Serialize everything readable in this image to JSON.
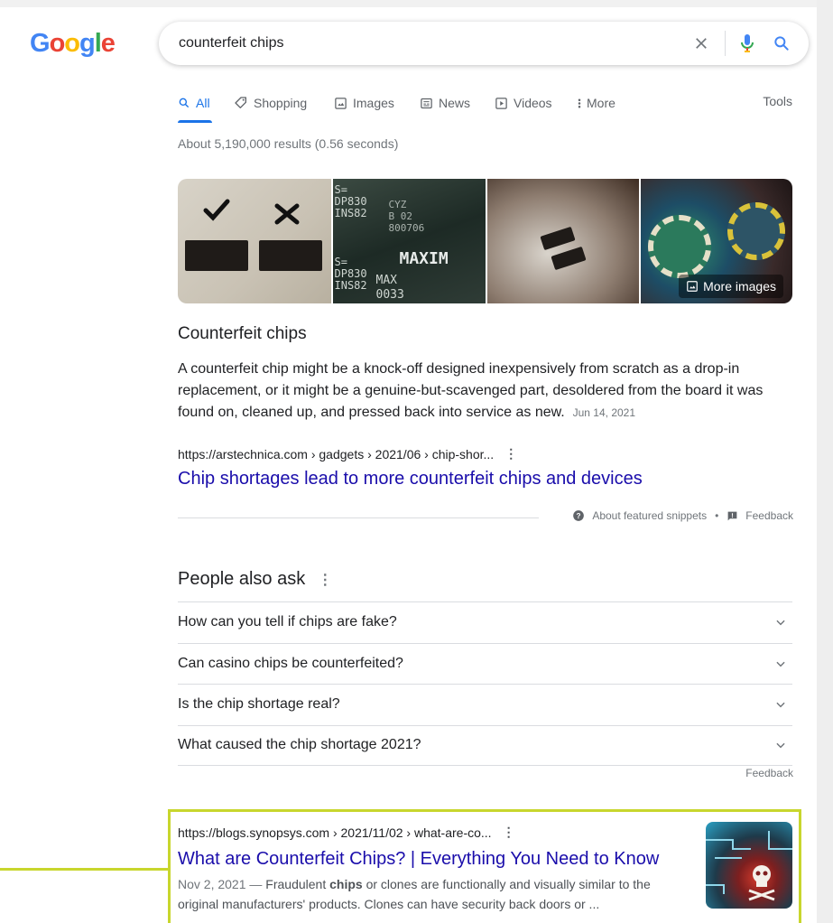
{
  "header": {
    "logo": "Google",
    "query": "counterfeit chips",
    "icons": [
      "close-icon",
      "mic-icon",
      "search-icon"
    ]
  },
  "tabs": [
    {
      "label": "All",
      "icon": "search-icon",
      "active": true
    },
    {
      "label": "Shopping",
      "icon": "tag-icon"
    },
    {
      "label": "Images",
      "icon": "image-icon"
    },
    {
      "label": "News",
      "icon": "news-icon"
    },
    {
      "label": "Videos",
      "icon": "play-icon"
    },
    {
      "label": "More",
      "icon": "more-vert-icon"
    }
  ],
  "tools_label": "Tools",
  "stats": "About 5,190,000 results (0.56 seconds)",
  "images": {
    "more_label": "More images",
    "overlay_text": [
      "S=",
      "DP830",
      "INS82",
      "CYZ",
      "B 02",
      "800706",
      "S=",
      "DP830",
      "INS82",
      "MAXIM",
      "MAX",
      "0033"
    ]
  },
  "featured_snippet": {
    "title": "Counterfeit chips",
    "text": "A counterfeit chip might be a knock-off designed inexpensively from scratch as a drop-in replacement, or it might be a genuine-but-scavenged part, desoldered from the board it was found on, cleaned up, and pressed back into service as new.",
    "date": "Jun 14, 2021",
    "url": "https://arstechnica.com › gadgets › 2021/06 › chip-shor...",
    "link": "Chip shortages lead to more counterfeit chips and devices",
    "about_label": "About featured snippets",
    "separator": "•",
    "feedback_label": "Feedback"
  },
  "people_also_ask": {
    "title": "People also ask",
    "questions": [
      "How can you tell if chips are fake?",
      "Can casino chips be counterfeited?",
      "Is the chip shortage real?",
      "What caused the chip shortage 2021?"
    ],
    "feedback_label": "Feedback"
  },
  "result": {
    "url": "https://blogs.synopsys.com › 2021/11/02 › what-are-co...",
    "title": "What are Counterfeit Chips? | Everything You Need to Know",
    "date": "Nov 2, 2021 — ",
    "snippet_pre": "Fraudulent ",
    "snippet_bold": "chips",
    "snippet_post": " or clones are functionally and visually similar to the original manufacturers' products. Clones can have security back doors or ..."
  },
  "colors": {
    "link": "#1a0dab",
    "accent": "#1a73e8",
    "highlight": "#c8d62d"
  }
}
